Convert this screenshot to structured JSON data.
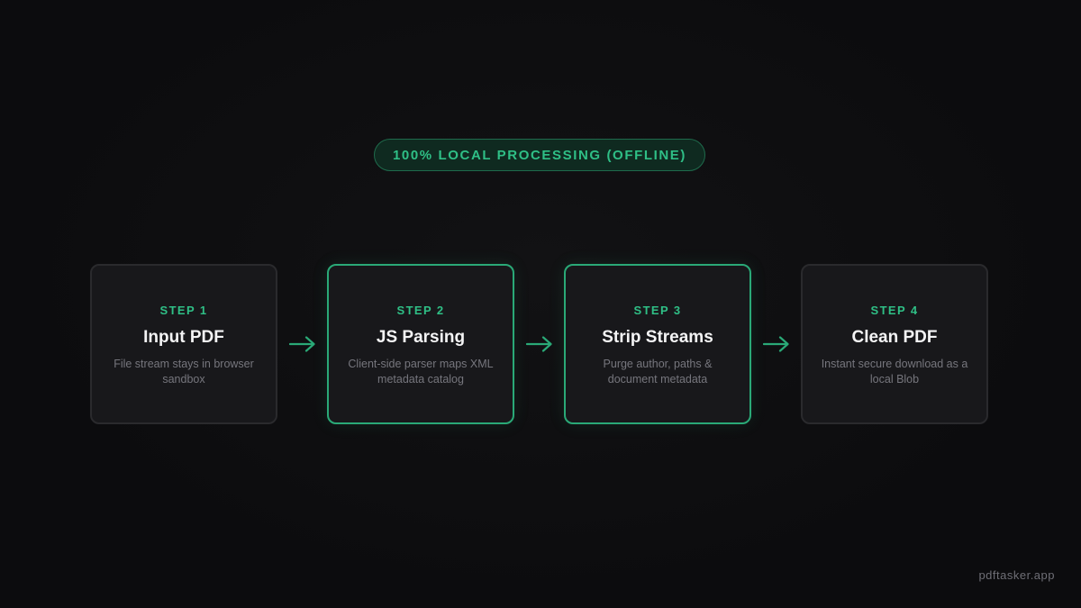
{
  "badge": {
    "label": "100% LOCAL PROCESSING (OFFLINE)"
  },
  "steps": [
    {
      "label": "STEP 1",
      "title": "Input PDF",
      "description": "File stream stays in browser sandbox",
      "highlighted": false
    },
    {
      "label": "STEP 2",
      "title": "JS Parsing",
      "description": "Client-side parser maps XML metadata catalog",
      "highlighted": true
    },
    {
      "label": "STEP 3",
      "title": "Strip Streams",
      "description": "Purge author, paths & document metadata",
      "highlighted": true
    },
    {
      "label": "STEP 4",
      "title": "Clean PDF",
      "description": "Instant secure download as a local Blob",
      "highlighted": false
    }
  ],
  "arrow_icon": "arrow-right-icon",
  "footer": {
    "brand": "pdftasker.app"
  },
  "colors": {
    "accent": "#2fbf86",
    "accent_border": "#2aa977",
    "background": "#0d0d0f",
    "card": "#18181b"
  }
}
